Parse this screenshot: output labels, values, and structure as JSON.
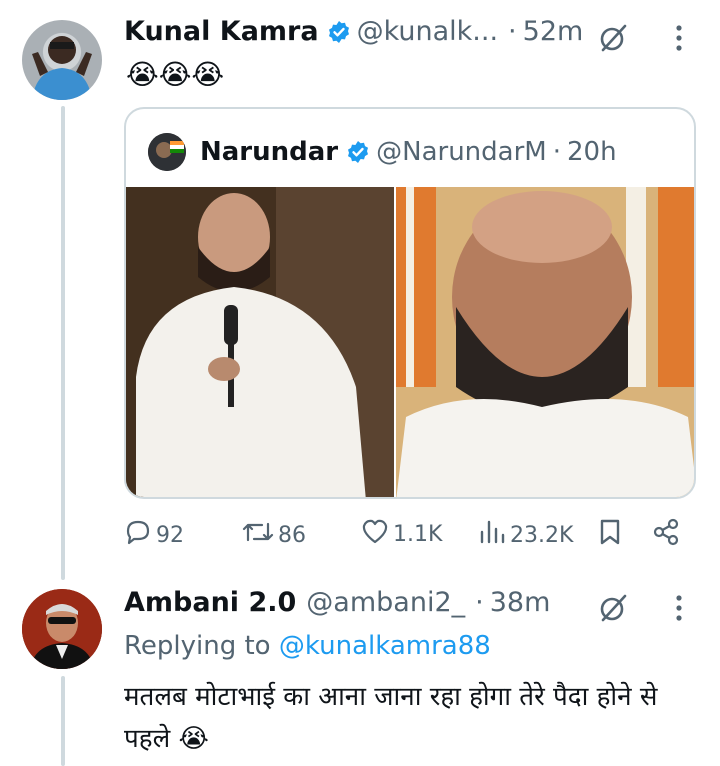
{
  "tweet": {
    "author_name": "Kunal Kamra",
    "author_handle": "@kunalk...",
    "separator": "·",
    "time": "52m",
    "text": "😭😭😭",
    "quote": {
      "author_name": "Narundar",
      "author_handle": "@NarundarM",
      "separator": "·",
      "time": "20h"
    },
    "actions": {
      "replies": "92",
      "retweets": "86",
      "likes": "1.1K",
      "views": "23.2K"
    }
  },
  "reply": {
    "author_name": "Ambani 2.0",
    "author_handle": "@ambani2_",
    "separator": "·",
    "time": "38m",
    "replying_prefix": "Replying to",
    "replying_to": "@kunalkamra88",
    "text": "मतलब मोटाभाई का आना जाना रहा होगा तेरे पैदा होने से पहले 😭"
  },
  "colors": {
    "verified": "#1d9bf0",
    "muted": "#536471",
    "link": "#1d9bf0"
  },
  "icons": [
    "verified-badge-icon",
    "grok-icon",
    "more-icon",
    "reply-icon",
    "retweet-icon",
    "like-icon",
    "views-icon",
    "bookmark-icon",
    "share-icon"
  ]
}
